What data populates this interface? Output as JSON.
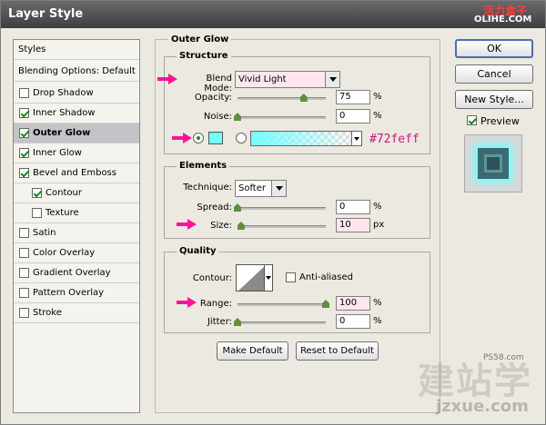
{
  "window": {
    "title": "Layer Style"
  },
  "watermark": {
    "cn": "活力盒子",
    "en": "OLIHE.COM",
    "big": "建站学",
    "small": "jzxue.com",
    "ps": "PS58.com"
  },
  "sidebar": {
    "items": [
      {
        "label": "Styles",
        "checkbox": false
      },
      {
        "label": "Blending Options: Default",
        "checkbox": false
      },
      {
        "label": "Drop Shadow",
        "checkbox": true,
        "checked": false
      },
      {
        "label": "Inner Shadow",
        "checkbox": true,
        "checked": true
      },
      {
        "label": "Outer Glow",
        "checkbox": true,
        "checked": true,
        "selected": true
      },
      {
        "label": "Inner Glow",
        "checkbox": true,
        "checked": true
      },
      {
        "label": "Bevel and Emboss",
        "checkbox": true,
        "checked": true
      },
      {
        "label": "Contour",
        "checkbox": true,
        "checked": true,
        "indent": true
      },
      {
        "label": "Texture",
        "checkbox": true,
        "checked": false,
        "indent": true
      },
      {
        "label": "Satin",
        "checkbox": true,
        "checked": false
      },
      {
        "label": "Color Overlay",
        "checkbox": true,
        "checked": false
      },
      {
        "label": "Gradient Overlay",
        "checkbox": true,
        "checked": false
      },
      {
        "label": "Pattern Overlay",
        "checkbox": true,
        "checked": false
      },
      {
        "label": "Stroke",
        "checkbox": true,
        "checked": false
      }
    ]
  },
  "panel": {
    "title": "Outer Glow",
    "structure": {
      "title": "Structure",
      "blend_mode_label": "Blend Mode:",
      "blend_mode_value": "Vivid Light",
      "opacity_label": "Opacity:",
      "opacity_value": "75",
      "opacity_unit": "%",
      "opacity_fraction": 0.75,
      "noise_label": "Noise:",
      "noise_value": "0",
      "noise_unit": "%",
      "noise_fraction": 0,
      "glow_color": "#72feff",
      "glow_color_label": "#72feff"
    },
    "elements": {
      "title": "Elements",
      "technique_label": "Technique:",
      "technique_value": "Softer",
      "spread_label": "Spread:",
      "spread_value": "0",
      "spread_unit": "%",
      "spread_fraction": 0,
      "size_label": "Size:",
      "size_value": "10",
      "size_unit": "px",
      "size_fraction": 0.04
    },
    "quality": {
      "title": "Quality",
      "contour_label": "Contour:",
      "anti_aliased_label": "Anti-aliased",
      "anti_aliased_checked": false,
      "range_label": "Range:",
      "range_value": "100",
      "range_unit": "%",
      "range_fraction": 1.0,
      "jitter_label": "Jitter:",
      "jitter_value": "0",
      "jitter_unit": "%",
      "jitter_fraction": 0
    },
    "make_default_label": "Make Default",
    "reset_default_label": "Reset to Default"
  },
  "buttons": {
    "ok": "OK",
    "cancel": "Cancel",
    "new_style": "New Style...",
    "preview_label": "Preview",
    "preview_checked": true
  },
  "colors": {
    "highlight": "#ff1493",
    "glow": "#72feff",
    "accent_text": "#d2147f"
  }
}
